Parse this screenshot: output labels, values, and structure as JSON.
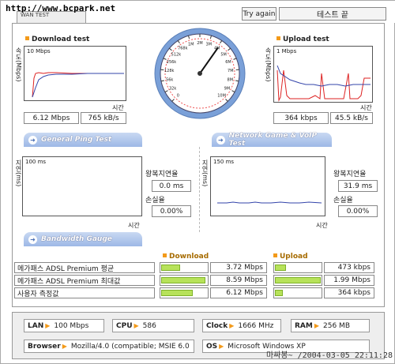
{
  "site_url": "http://www.bcpark.net",
  "tab_title": "WAN TEST",
  "try_again": "Try again",
  "end_test": "테스트 끝",
  "download": {
    "title": "Download test",
    "scale": "10 Mbps",
    "y_label": "속도(Mbps)",
    "x_label": "시간",
    "speed": "6.12 Mbps",
    "rate": "765 kB/s"
  },
  "upload": {
    "title": "Upload test",
    "scale": "1 Mbps",
    "y_label": "속도(Mbps)",
    "x_label": "시간",
    "speed": "364 kbps",
    "rate": "45.5 kB/s"
  },
  "gauge": {
    "ticks": [
      "0",
      "32k",
      "56k",
      "128k",
      "256k",
      "512k",
      "768k",
      "1M",
      "2M",
      "3M",
      "4M",
      "5M",
      "6M",
      "7M",
      "8M",
      "9M",
      "10M"
    ],
    "value_fraction": 0.63
  },
  "ping_tab": "General Ping Test",
  "game_tab": "Network Game & VoIP Test",
  "ping": {
    "scale": "100 ms",
    "y_label": "지연(ms)",
    "x_label": "시간",
    "latency_label": "왕복지연율",
    "latency": "0.0 ms",
    "loss_label": "손실율",
    "loss": "0.00%"
  },
  "game": {
    "scale": "150 ms",
    "y_label": "지연(ms)",
    "x_label": "시간",
    "latency_label": "왕복지연율",
    "latency": "31.9 ms",
    "loss_label": "손실율",
    "loss": "0.00%"
  },
  "bandwidth_tab": "Bandwidth Gauge",
  "bandwidth": {
    "download_header": "Download",
    "upload_header": "Upload",
    "rows": [
      {
        "label": "메가패스 ADSL Premium 평균",
        "down": "3.72 Mbps",
        "down_frac": 0.42,
        "up": "473 kbps",
        "up_frac": 0.24
      },
      {
        "label": "메가패스 ADSL Premium 최대값",
        "down": "8.59 Mbps",
        "down_frac": 0.97,
        "up": "1.99 Mbps",
        "up_frac": 1.0
      },
      {
        "label": "사용자 측정값",
        "down": "6.12 Mbps",
        "down_frac": 0.69,
        "up": "364 kbps",
        "up_frac": 0.18
      }
    ]
  },
  "info": {
    "lan_label": "LAN",
    "lan": "100 Mbps",
    "cpu_label": "CPU",
    "cpu": "586",
    "clock_label": "Clock",
    "clock": "1666 MHz",
    "ram_label": "RAM",
    "ram": "256 MB",
    "browser_label": "Browser",
    "browser": "Mozilla/4.0 (compatible; MSIE 6.0",
    "os_label": "OS",
    "os": "Microsoft Windows XP"
  },
  "watermark": "마싸봉~ /2004-03-05 22:11:28",
  "colors": {
    "accent": "#f39a1a",
    "tab_blue": "#9db8e6",
    "bar_green": "#b7e25a",
    "line_red": "#d22",
    "line_blue": "#3344aa"
  }
}
